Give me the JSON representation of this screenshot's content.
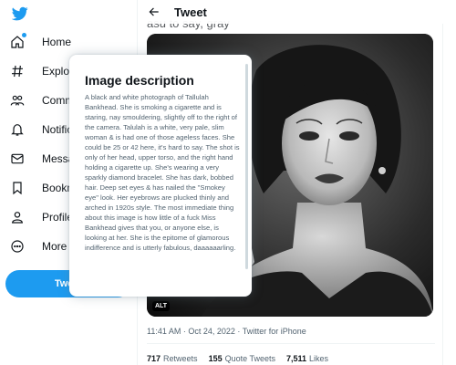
{
  "sidebar": {
    "logo_icon": "twitter-bird-icon",
    "items": [
      {
        "label": "Home",
        "icon": "home-icon"
      },
      {
        "label": "Explore",
        "icon": "hashtag-icon"
      },
      {
        "label": "Communities",
        "icon": "communities-icon"
      },
      {
        "label": "Notifications",
        "icon": "bell-icon"
      },
      {
        "label": "Messages",
        "icon": "envelope-icon"
      },
      {
        "label": "Bookmarks",
        "icon": "bookmark-icon"
      },
      {
        "label": "Profile",
        "icon": "person-icon"
      },
      {
        "label": "More",
        "icon": "more-circle-icon"
      }
    ],
    "tweet_button": "Tweet"
  },
  "header": {
    "title": "Tweet",
    "back_icon": "arrow-left-icon"
  },
  "tweet": {
    "cut_text": "asu to say, gray",
    "alt_badge": "ALT",
    "meta": "11:41 AM · Oct 24, 2022 · Twitter for iPhone",
    "stats": {
      "retweets_count": "717",
      "retweets_label": "Retweets",
      "quotes_count": "155",
      "quotes_label": "Quote Tweets",
      "likes_count": "7,511",
      "likes_label": "Likes"
    }
  },
  "image_description": {
    "title": "Image description",
    "body": "A black and white photograph of Tallulah Bankhead. She is smoking a cigarette and is staring, nay smouldering, slightly off to the right of the camera. Talulah is a white, very pale, slim woman & is had one of those ageless faces. She could be 25 or 42 here, it's hard to say. The shot is only of her head, upper torso, and the right hand holding a cigarette up. She's wearing a very sparkly diamond bracelet. She has dark, bobbed hair. Deep set eyes & has nailed the \"Smokey eye\" look. Her eyebrows are plucked thinly and arched in 1920s style. The most immediate thing about this image is how little of a fuck Miss Bankhead gives that you, or anyone else, is looking at her. She is the epitome of glamorous indifference and is utterly fabulous, daaaaaarling."
  },
  "colors": {
    "accent": "#1d9bf0",
    "text": "#0f1419",
    "secondary_text": "#536471"
  }
}
